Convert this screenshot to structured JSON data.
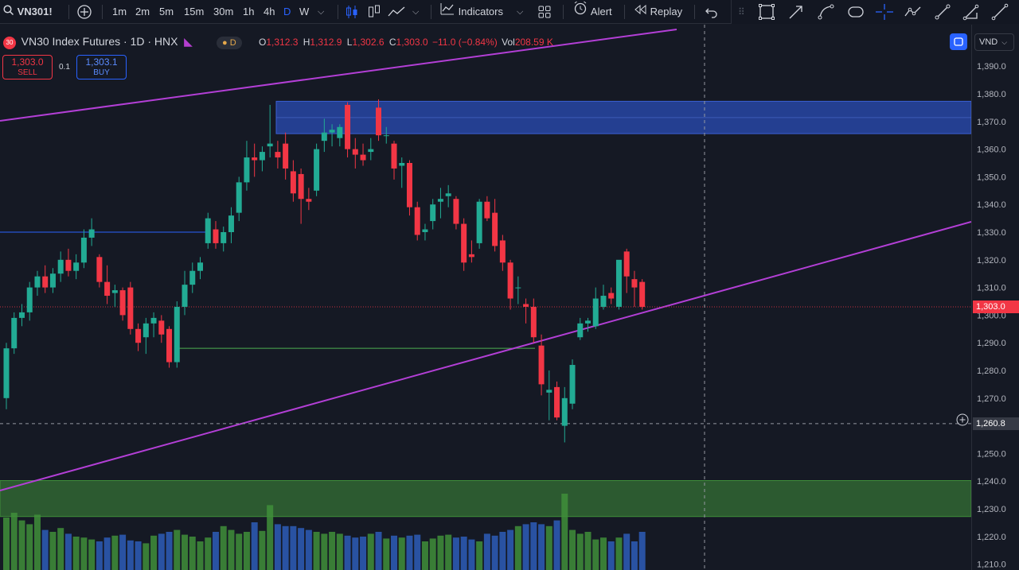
{
  "toolbar": {
    "symbol": "VN301!",
    "intervals": [
      "1m",
      "2m",
      "5m",
      "15m",
      "30m",
      "1h",
      "4h",
      "D",
      "W"
    ],
    "active_interval": "D",
    "indicators_label": "Indicators",
    "alert_label": "Alert",
    "replay_label": "Replay"
  },
  "legend": {
    "badge": "30",
    "title": "VN30 Index Futures · 1D · HNX",
    "session_badge": "D",
    "open_key": "O",
    "open": "1,312.3",
    "high_key": "H",
    "high": "1,312.9",
    "low_key": "L",
    "low": "1,302.6",
    "close_key": "C",
    "close": "1,303.0",
    "change": "−11.0 (−0.84%)",
    "vol_key": "Vol",
    "vol": "208.59 K"
  },
  "trade": {
    "sell_price": "1,303.0",
    "sell_label": "SELL",
    "spread": "0.1",
    "buy_price": "1,303.1",
    "buy_label": "BUY"
  },
  "axis": {
    "currency": "VND",
    "ticks": [
      "1,390.0",
      "1,380.0",
      "1,370.0",
      "1,360.0",
      "1,350.0",
      "1,340.0",
      "1,330.0",
      "1,320.0",
      "1,310.0",
      "1,300.0",
      "1,290.0",
      "1,280.0",
      "1,270.0",
      "1,260.0",
      "1,250.0",
      "1,240.0",
      "1,230.0",
      "1,220.0",
      "1,210.0"
    ],
    "last_price": "1,303.0",
    "crosshair_price": "1,260.8"
  },
  "colors": {
    "up": "#22ab94",
    "down": "#f23645",
    "trendline": "#b33fd6",
    "zone_blue": "#2a4cb5",
    "zone_green": "#3f8f3a",
    "vol_up": "#3f8f3a",
    "vol_down": "#2d5db8"
  },
  "chart_data": {
    "type": "candlestick",
    "ylim": [
      1205,
      1395
    ],
    "candles": [
      {
        "o": 1270,
        "h": 1290,
        "l": 1266,
        "c": 1288
      },
      {
        "o": 1288,
        "h": 1301,
        "l": 1286,
        "c": 1299
      },
      {
        "o": 1299,
        "h": 1304,
        "l": 1296,
        "c": 1301
      },
      {
        "o": 1301,
        "h": 1312,
        "l": 1298,
        "c": 1310
      },
      {
        "o": 1310,
        "h": 1316,
        "l": 1307,
        "c": 1314
      },
      {
        "o": 1314,
        "h": 1318,
        "l": 1308,
        "c": 1310
      },
      {
        "o": 1310,
        "h": 1317,
        "l": 1308,
        "c": 1315
      },
      {
        "o": 1315,
        "h": 1323,
        "l": 1312,
        "c": 1320
      },
      {
        "o": 1320,
        "h": 1324,
        "l": 1314,
        "c": 1316
      },
      {
        "o": 1316,
        "h": 1322,
        "l": 1313,
        "c": 1319
      },
      {
        "o": 1319,
        "h": 1331,
        "l": 1317,
        "c": 1328
      },
      {
        "o": 1328,
        "h": 1335,
        "l": 1325,
        "c": 1331
      },
      {
        "o": 1321,
        "h": 1322,
        "l": 1310,
        "c": 1312
      },
      {
        "o": 1312,
        "h": 1318,
        "l": 1304,
        "c": 1307
      },
      {
        "o": 1308,
        "h": 1311,
        "l": 1303,
        "c": 1309
      },
      {
        "o": 1309,
        "h": 1310,
        "l": 1298,
        "c": 1300
      },
      {
        "o": 1310,
        "h": 1312,
        "l": 1293,
        "c": 1295
      },
      {
        "o": 1295,
        "h": 1297,
        "l": 1287,
        "c": 1290
      },
      {
        "o": 1292,
        "h": 1299,
        "l": 1286,
        "c": 1297
      },
      {
        "o": 1297,
        "h": 1301,
        "l": 1292,
        "c": 1299
      },
      {
        "o": 1298,
        "h": 1300,
        "l": 1290,
        "c": 1293
      },
      {
        "o": 1295,
        "h": 1296,
        "l": 1281,
        "c": 1283
      },
      {
        "o": 1283,
        "h": 1305,
        "l": 1281,
        "c": 1303
      },
      {
        "o": 1303,
        "h": 1316,
        "l": 1300,
        "c": 1311
      },
      {
        "o": 1311,
        "h": 1319,
        "l": 1308,
        "c": 1316
      },
      {
        "o": 1316,
        "h": 1321,
        "l": 1313,
        "c": 1319
      },
      {
        "o": 1326,
        "h": 1337,
        "l": 1324,
        "c": 1335
      },
      {
        "o": 1331,
        "h": 1334,
        "l": 1324,
        "c": 1326
      },
      {
        "o": 1326,
        "h": 1332,
        "l": 1323,
        "c": 1330
      },
      {
        "o": 1330,
        "h": 1339,
        "l": 1326,
        "c": 1336
      },
      {
        "o": 1337,
        "h": 1350,
        "l": 1334,
        "c": 1348
      },
      {
        "o": 1348,
        "h": 1363,
        "l": 1345,
        "c": 1357
      },
      {
        "o": 1357,
        "h": 1362,
        "l": 1350,
        "c": 1356
      },
      {
        "o": 1356,
        "h": 1361,
        "l": 1352,
        "c": 1359
      },
      {
        "o": 1361,
        "h": 1376,
        "l": 1357,
        "c": 1362
      },
      {
        "o": 1359,
        "h": 1363,
        "l": 1353,
        "c": 1357
      },
      {
        "o": 1362,
        "h": 1366,
        "l": 1349,
        "c": 1353
      },
      {
        "o": 1352,
        "h": 1356,
        "l": 1341,
        "c": 1344
      },
      {
        "o": 1351,
        "h": 1353,
        "l": 1333,
        "c": 1342
      },
      {
        "o": 1342,
        "h": 1346,
        "l": 1338,
        "c": 1341
      },
      {
        "o": 1345,
        "h": 1362,
        "l": 1343,
        "c": 1360
      },
      {
        "o": 1363,
        "h": 1371,
        "l": 1359,
        "c": 1366
      },
      {
        "o": 1366,
        "h": 1369,
        "l": 1361,
        "c": 1367
      },
      {
        "o": 1364,
        "h": 1369,
        "l": 1361,
        "c": 1368
      },
      {
        "o": 1376,
        "h": 1377,
        "l": 1357,
        "c": 1360
      },
      {
        "o": 1360,
        "h": 1364,
        "l": 1353,
        "c": 1358
      },
      {
        "o": 1358,
        "h": 1362,
        "l": 1354,
        "c": 1356
      },
      {
        "o": 1359,
        "h": 1364,
        "l": 1356,
        "c": 1360
      },
      {
        "o": 1375,
        "h": 1378,
        "l": 1363,
        "c": 1365
      },
      {
        "o": 1365,
        "h": 1368,
        "l": 1362,
        "c": 1365
      },
      {
        "o": 1362,
        "h": 1363,
        "l": 1349,
        "c": 1353
      },
      {
        "o": 1354,
        "h": 1357,
        "l": 1346,
        "c": 1355
      },
      {
        "o": 1355,
        "h": 1356,
        "l": 1336,
        "c": 1339
      },
      {
        "o": 1339,
        "h": 1341,
        "l": 1327,
        "c": 1329
      },
      {
        "o": 1330,
        "h": 1333,
        "l": 1327,
        "c": 1331
      },
      {
        "o": 1334,
        "h": 1342,
        "l": 1331,
        "c": 1340
      },
      {
        "o": 1341,
        "h": 1346,
        "l": 1335,
        "c": 1342
      },
      {
        "o": 1343,
        "h": 1347,
        "l": 1339,
        "c": 1344
      },
      {
        "o": 1342,
        "h": 1343,
        "l": 1331,
        "c": 1333
      },
      {
        "o": 1333,
        "h": 1335,
        "l": 1316,
        "c": 1319
      },
      {
        "o": 1322,
        "h": 1327,
        "l": 1319,
        "c": 1321
      },
      {
        "o": 1326,
        "h": 1342,
        "l": 1324,
        "c": 1341
      },
      {
        "o": 1341,
        "h": 1343,
        "l": 1334,
        "c": 1335
      },
      {
        "o": 1337,
        "h": 1342,
        "l": 1323,
        "c": 1325
      },
      {
        "o": 1327,
        "h": 1329,
        "l": 1316,
        "c": 1319
      },
      {
        "o": 1319,
        "h": 1320,
        "l": 1302,
        "c": 1306
      },
      {
        "o": 1310,
        "h": 1314,
        "l": 1304,
        "c": 1310
      },
      {
        "o": 1304,
        "h": 1306,
        "l": 1297,
        "c": 1303
      },
      {
        "o": 1303,
        "h": 1306,
        "l": 1290,
        "c": 1292
      },
      {
        "o": 1289,
        "h": 1293,
        "l": 1271,
        "c": 1275
      },
      {
        "o": 1272,
        "h": 1280,
        "l": 1262,
        "c": 1273
      },
      {
        "o": 1274,
        "h": 1276,
        "l": 1262,
        "c": 1263
      },
      {
        "o": 1260,
        "h": 1274,
        "l": 1254,
        "c": 1270
      },
      {
        "o": 1268,
        "h": 1284,
        "l": 1266,
        "c": 1282
      },
      {
        "o": 1292,
        "h": 1299,
        "l": 1291,
        "c": 1297
      },
      {
        "o": 1297,
        "h": 1299,
        "l": 1294,
        "c": 1298
      },
      {
        "o": 1296,
        "h": 1310,
        "l": 1295,
        "c": 1306
      },
      {
        "o": 1303,
        "h": 1311,
        "l": 1302,
        "c": 1307
      },
      {
        "o": 1308,
        "h": 1310,
        "l": 1304,
        "c": 1306
      },
      {
        "o": 1303,
        "h": 1318,
        "l": 1302,
        "c": 1320
      },
      {
        "o": 1323,
        "h": 1324,
        "l": 1308,
        "c": 1314
      },
      {
        "o": 1313,
        "h": 1316,
        "l": 1303,
        "c": 1310
      },
      {
        "o": 1312,
        "h": 1313,
        "l": 1302,
        "c": 1303
      }
    ],
    "volume_pct": [
      55,
      60,
      52,
      48,
      58,
      42,
      40,
      44,
      38,
      35,
      34,
      32,
      30,
      34,
      36,
      37,
      31,
      30,
      28,
      36,
      38,
      40,
      42,
      37,
      35,
      30,
      34,
      40,
      46,
      42,
      38,
      40,
      50,
      41,
      68,
      48,
      46,
      46,
      44,
      42,
      40,
      38,
      40,
      38,
      36,
      34,
      35,
      38,
      40,
      33,
      36,
      34,
      36,
      37,
      30,
      33,
      36,
      37,
      34,
      35,
      32,
      30,
      38,
      36,
      40,
      42,
      46,
      48,
      50,
      48,
      46,
      52,
      80,
      42,
      38,
      40,
      32,
      34,
      30,
      34,
      38,
      30,
      40,
      40
    ]
  }
}
